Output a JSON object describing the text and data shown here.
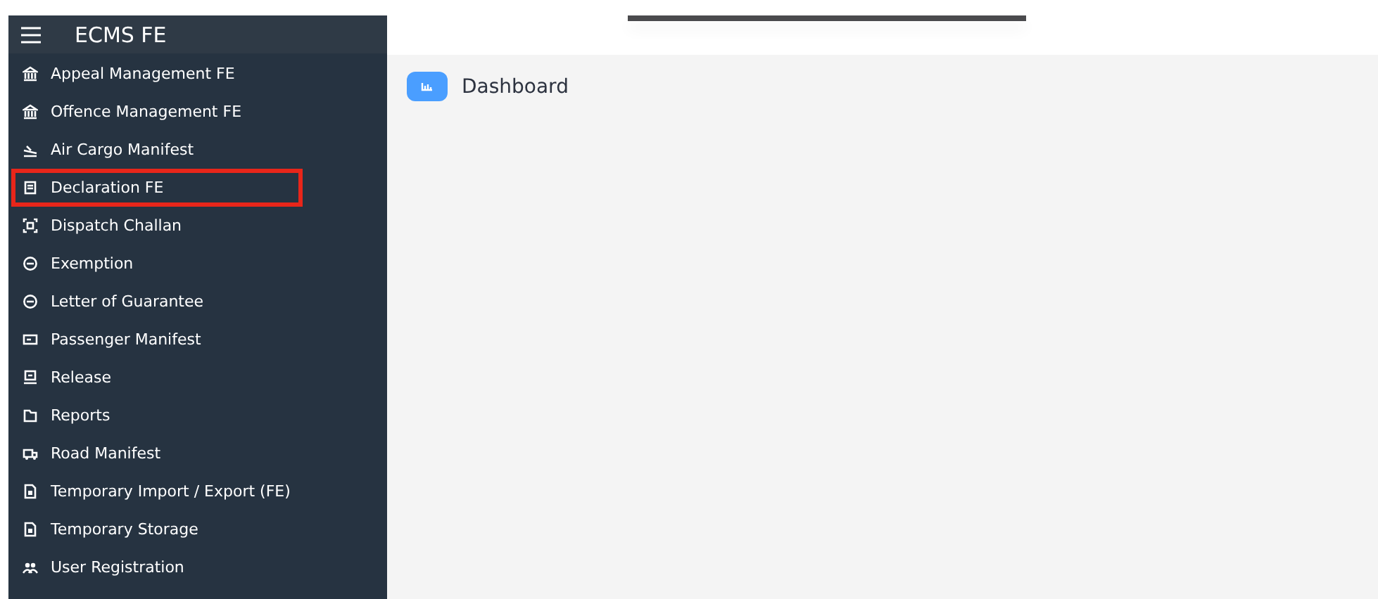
{
  "sidebar": {
    "title": "ECMS FE",
    "items": [
      {
        "label": "Appeal Management FE",
        "highlighted": false
      },
      {
        "label": "Offence Management FE",
        "highlighted": false
      },
      {
        "label": "Air Cargo Manifest",
        "highlighted": false
      },
      {
        "label": "Declaration FE",
        "highlighted": true
      },
      {
        "label": "Dispatch Challan",
        "highlighted": false
      },
      {
        "label": "Exemption",
        "highlighted": false
      },
      {
        "label": "Letter of Guarantee",
        "highlighted": false
      },
      {
        "label": "Passenger Manifest",
        "highlighted": false
      },
      {
        "label": "Release",
        "highlighted": false
      },
      {
        "label": "Reports",
        "highlighted": false
      },
      {
        "label": "Road Manifest",
        "highlighted": false
      },
      {
        "label": "Temporary Import / Export (FE)",
        "highlighted": false
      },
      {
        "label": "Temporary Storage",
        "highlighted": false
      },
      {
        "label": "User Registration",
        "highlighted": false
      }
    ]
  },
  "main": {
    "title": "Dashboard"
  }
}
